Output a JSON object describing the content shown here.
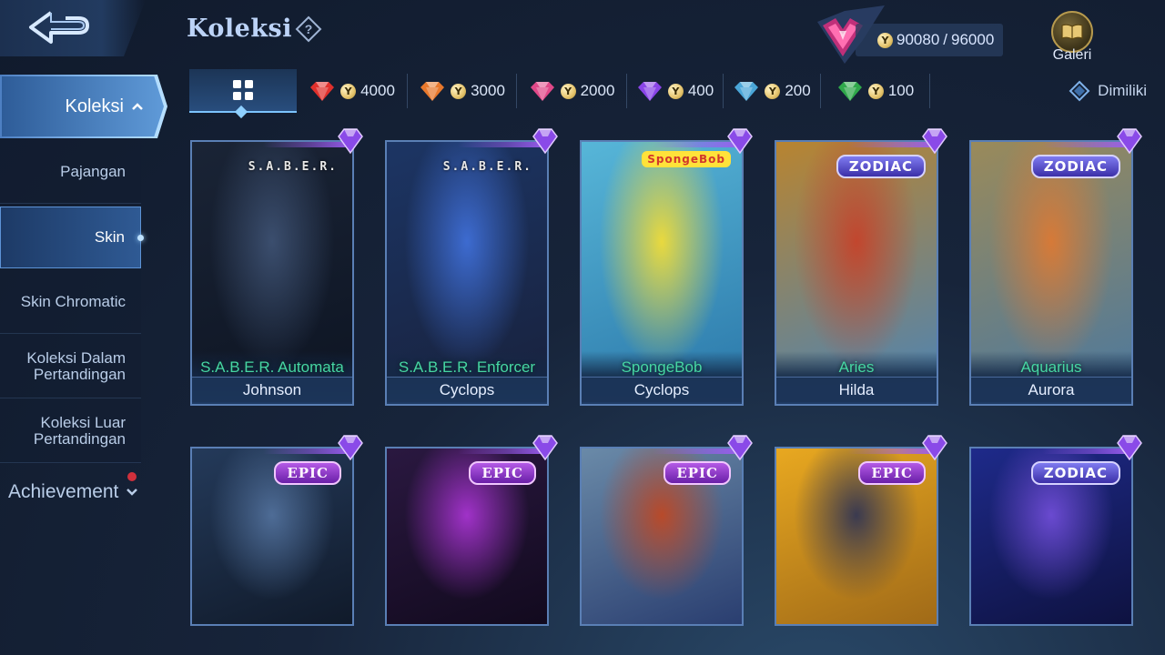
{
  "header": {
    "title": "Koleksi",
    "points_current": "90080",
    "points_max": "96000",
    "galeri_label": "Galeri"
  },
  "sidebar": {
    "main_label": "Koleksi",
    "items": [
      {
        "label": "Pajangan",
        "active": false
      },
      {
        "label": "Skin",
        "active": true
      },
      {
        "label": "Skin Chromatic",
        "active": false
      },
      {
        "label": "Koleksi Dalam Pertandingan",
        "active": false
      },
      {
        "label": "Koleksi Luar Pertandingan",
        "active": false
      }
    ],
    "achievement_label": "Achievement"
  },
  "filters": {
    "tabs": [
      {
        "value": "4000",
        "gem_color": "#e0302c"
      },
      {
        "value": "3000",
        "gem_color": "#e8782c"
      },
      {
        "value": "2000",
        "gem_color": "#e04888"
      },
      {
        "value": "400",
        "gem_color": "#8a44e8"
      },
      {
        "value": "200",
        "gem_color": "#4aa6d8"
      },
      {
        "value": "100",
        "gem_color": "#2fa84a"
      }
    ],
    "owned_label": "Dimiliki"
  },
  "cards": [
    {
      "skin": "S.A.B.E.R. Automata",
      "hero": "Johnson",
      "badge": "S.A.B.E.R.",
      "badge_type": "saber",
      "art": [
        "#1a2436",
        "#3b4e6e",
        "#0d1422"
      ]
    },
    {
      "skin": "S.A.B.E.R. Enforcer",
      "hero": "Cyclops",
      "badge": "S.A.B.E.R.",
      "badge_type": "saber",
      "art": [
        "#1c3564",
        "#3d6bd0",
        "#18213c"
      ]
    },
    {
      "skin": "SpongeBob",
      "hero": "Cyclops",
      "badge": "SpongeBob",
      "badge_type": "spongebob",
      "art": [
        "#57b6d8",
        "#e9d93e",
        "#2a76a8"
      ]
    },
    {
      "skin": "Aries",
      "hero": "Hilda",
      "badge": "ZODIAC",
      "badge_type": "zodiac",
      "art": [
        "#b88430",
        "#c2462e",
        "#4a84b8"
      ]
    },
    {
      "skin": "Aquarius",
      "hero": "Aurora",
      "badge": "ZODIAC",
      "badge_type": "zodiac",
      "art": [
        "#9a8a5a",
        "#d67a38",
        "#4a78a0"
      ]
    },
    {
      "skin": "",
      "hero": "",
      "badge": "EPIC",
      "badge_type": "epic",
      "art": [
        "#243a5a",
        "#4e6c96",
        "#101a2a"
      ]
    },
    {
      "skin": "",
      "hero": "",
      "badge": "EPIC",
      "badge_type": "epic",
      "art": [
        "#2a1840",
        "#a032c8",
        "#120a1e"
      ]
    },
    {
      "skin": "",
      "hero": "",
      "badge": "EPIC",
      "badge_type": "epic",
      "art": [
        "#6a8aa8",
        "#b84a2a",
        "#2a3e70"
      ]
    },
    {
      "skin": "",
      "hero": "",
      "badge": "EPIC",
      "badge_type": "epic",
      "art": [
        "#e8a820",
        "#3a3a50",
        "#a06a18"
      ]
    },
    {
      "skin": "",
      "hero": "",
      "badge": "ZODIAC",
      "badge_type": "zodiac",
      "art": [
        "#1e2a8a",
        "#6a4ad0",
        "#0e1240"
      ]
    }
  ]
}
